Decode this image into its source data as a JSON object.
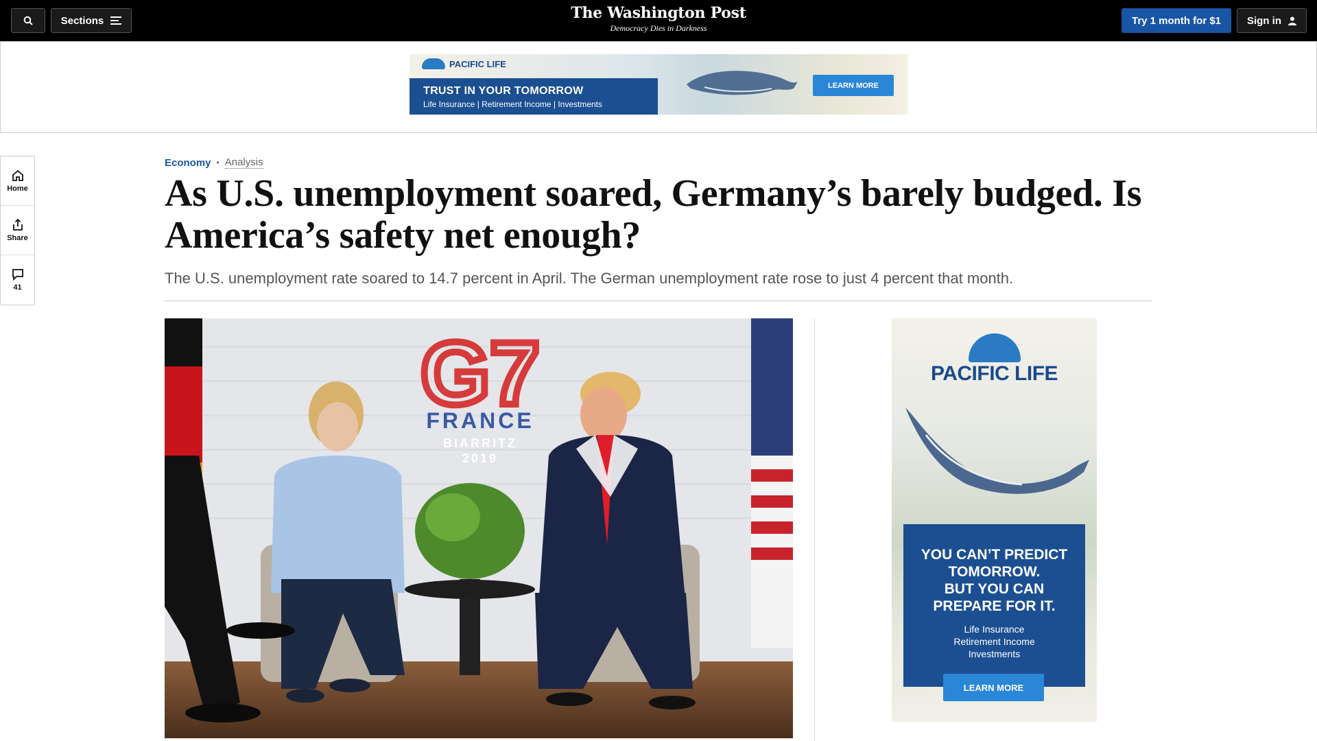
{
  "nav": {
    "sections_label": "Sections",
    "masthead": "The Washington Post",
    "tagline": "Democracy Dies in Darkness",
    "subscribe_label": "Try 1 month for $1",
    "signin_label": "Sign in"
  },
  "top_ad": {
    "brand": "PACIFIC LIFE",
    "headline": "TRUST IN YOUR TOMORROW",
    "subline": "Life Insurance | Retirement Income | Investments",
    "cta": "LEARN MORE"
  },
  "rail": {
    "home_label": "Home",
    "share_label": "Share",
    "comments_count": "41"
  },
  "article": {
    "section": "Economy",
    "label": "Analysis",
    "headline": "As U.S. unemployment soared, Germany’s barely budged. Is America’s safety net enough?",
    "dek": "The U.S. unemployment rate soared to 14.7 percent in April. The German unemployment rate rose to just 4 percent that month."
  },
  "lead_image": {
    "backdrop_title": "G7",
    "backdrop_country": "FRANCE",
    "backdrop_city": "BIARRITZ",
    "backdrop_year": "2019"
  },
  "side_ad": {
    "brand": "PACIFIC LIFE",
    "headline": "YOU CAN’T PREDICT\nTOMORROW.\nBUT YOU CAN\nPREPARE FOR IT.",
    "sub": "Life Insurance\nRetirement Income\nInvestments",
    "cta": "LEARN MORE"
  },
  "colors": {
    "nav_bg": "#000000",
    "accent": "#1955a5",
    "ad_blue": "#1b4f91",
    "ad_button": "#2a86d6"
  }
}
